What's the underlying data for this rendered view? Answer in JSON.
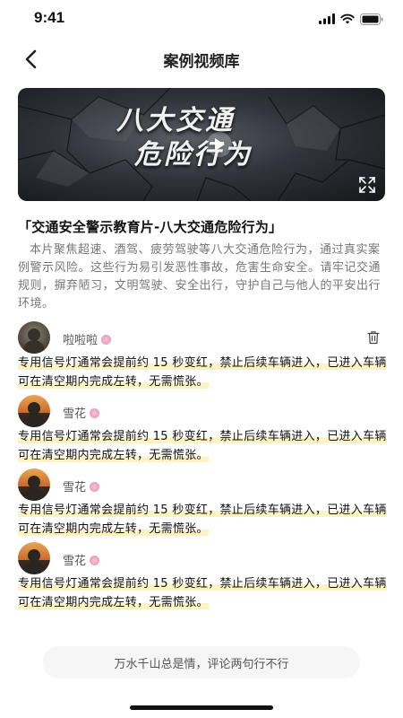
{
  "status_bar": {
    "time": "9:41",
    "icons": [
      "signal-icon",
      "wifi-icon",
      "battery-icon"
    ]
  },
  "nav": {
    "title": "案例视频库",
    "back_icon": "chevron-left-icon"
  },
  "video": {
    "title_line1": "八大交通",
    "title_line2": "危险行为",
    "play_icon": "play-icon",
    "fullscreen_icon": "fullscreen-icon"
  },
  "article": {
    "heading": "「交通安全警示教育片-八大交通危险行为」",
    "description": "本片聚焦超速、酒驾、疲劳驾驶等八大交通危险行为，通过真实案例警示风险。这些行为易引发恶性事故，危害生命安全。请牢记交通规则，摒弃陋习，文明驾驶、安全出行，守护自己与他人的平安出行环境。"
  },
  "comments": [
    {
      "username": "啦啦啦",
      "deletable": true,
      "text_a": "专用信号灯通常会提前约 15 秒变红，禁止后续车辆进入，已进入车辆可在清空期内完成左转，无需慌张。"
    },
    {
      "username": "雪花",
      "deletable": false,
      "text_a": "专用信号灯通常会提前约 15 秒变红，禁止后续车辆进入，已进入车辆可在清空期内完成左转，无需慌张。"
    },
    {
      "username": "雪花",
      "deletable": false,
      "text_a": "专用信号灯通常会提前约 15 秒变红，禁止后续车辆进入，已进入车辆可在清空期内完成左转，无需慌张。"
    },
    {
      "username": "雪花",
      "deletable": false,
      "text_a": "专用信号灯通常会提前约 15 秒变红，禁止后续车辆进入，已进入车辆可在清空期内完成左转，无需慌张。"
    }
  ],
  "input": {
    "placeholder": "万水千山总是情，评论两句行不行"
  },
  "colors": {
    "highlight": "#fbf3c4",
    "badge": "#e58bb0"
  }
}
